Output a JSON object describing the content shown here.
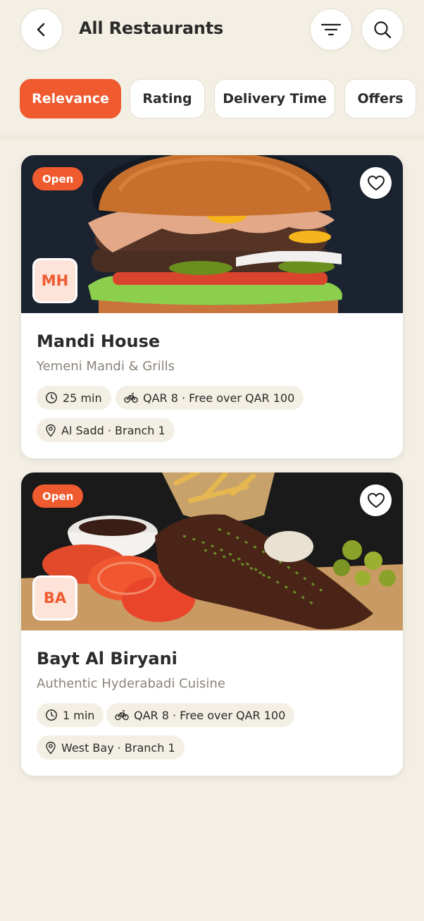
{
  "header": {
    "title": "All Restaurants",
    "back_icon": "chevron-left-icon",
    "filter_icon": "filter-lines-icon",
    "search_icon": "search-icon"
  },
  "sort_chips": [
    {
      "label": "Relevance",
      "active": true
    },
    {
      "label": "Rating",
      "active": false
    },
    {
      "label": "Delivery Time",
      "active": false
    },
    {
      "label": "Offers",
      "active": false
    }
  ],
  "colors": {
    "accent": "#ef5a2f",
    "background": "#f3efe4",
    "logo_bg": "#fde3d8",
    "text": "#2b2b2b",
    "muted": "#8a8379"
  },
  "restaurants": [
    {
      "status": "Open",
      "initials": "MH",
      "name": "Mandi House",
      "cuisine": "Yemeni Mandi & Grills",
      "delivery_time": "25 min",
      "delivery_fee": "QAR 8 · Free over QAR 100",
      "location": "Al Sadd · Branch 1"
    },
    {
      "status": "Open",
      "initials": "BA",
      "name": "Bayt Al Biryani",
      "cuisine": "Authentic Hyderabadi Cuisine",
      "delivery_time": "1 min",
      "delivery_fee": "QAR 8 · Free over QAR 100",
      "location": "West Bay · Branch 1"
    }
  ]
}
